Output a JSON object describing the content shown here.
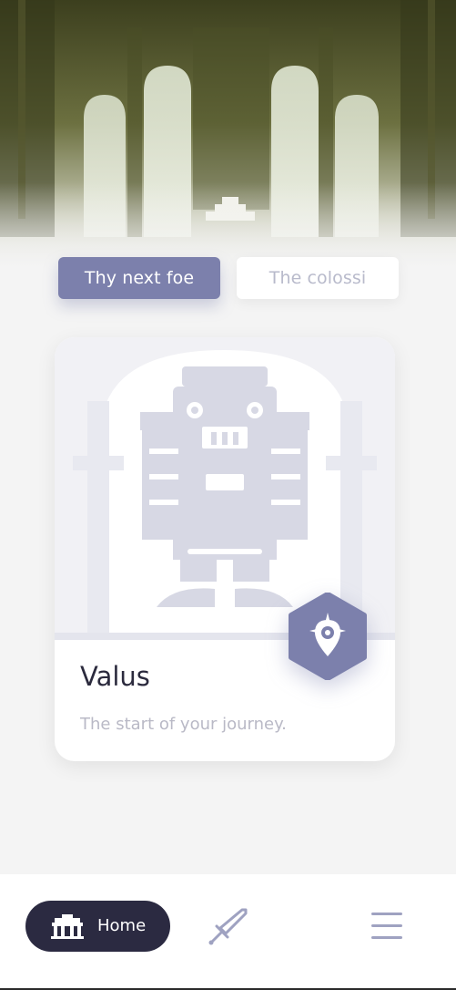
{
  "tabs": [
    {
      "label": "Thy next foe",
      "active": true
    },
    {
      "label": "The colossi",
      "active": false
    }
  ],
  "card": {
    "title": "Valus",
    "subtitle": "The start of your journey."
  },
  "nav": {
    "home_label": "Home",
    "home_icon": "temple-icon",
    "weapon_icon": "sword-icon",
    "menu_icon": "hamburger-menu-icon"
  },
  "colors": {
    "accent": "#7c80ac",
    "nav_dark": "#2b2a41",
    "text_dark": "#2b2a3d",
    "muted": "#b9b9c6"
  }
}
